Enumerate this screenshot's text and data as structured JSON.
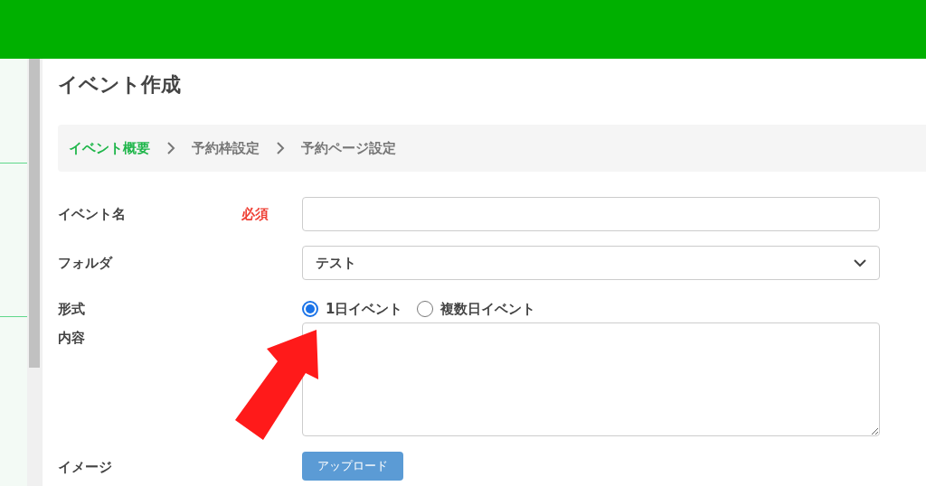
{
  "page_title": "イベント作成",
  "steps": [
    {
      "label": "イベント概要",
      "selected": true
    },
    {
      "label": "予約枠設定",
      "selected": false
    },
    {
      "label": "予約ページ設定",
      "selected": false
    }
  ],
  "form": {
    "event_name": {
      "label": "イベント名",
      "required_badge": "必須"
    },
    "folder": {
      "label": "フォルダ",
      "value": "テスト"
    },
    "format": {
      "label": "形式",
      "options": [
        {
          "label": "1日イベント",
          "selected": true
        },
        {
          "label": "複数日イベント",
          "selected": false
        }
      ]
    },
    "content": {
      "label": "内容"
    },
    "image": {
      "label": "イメージ",
      "button": "アップロード"
    }
  }
}
